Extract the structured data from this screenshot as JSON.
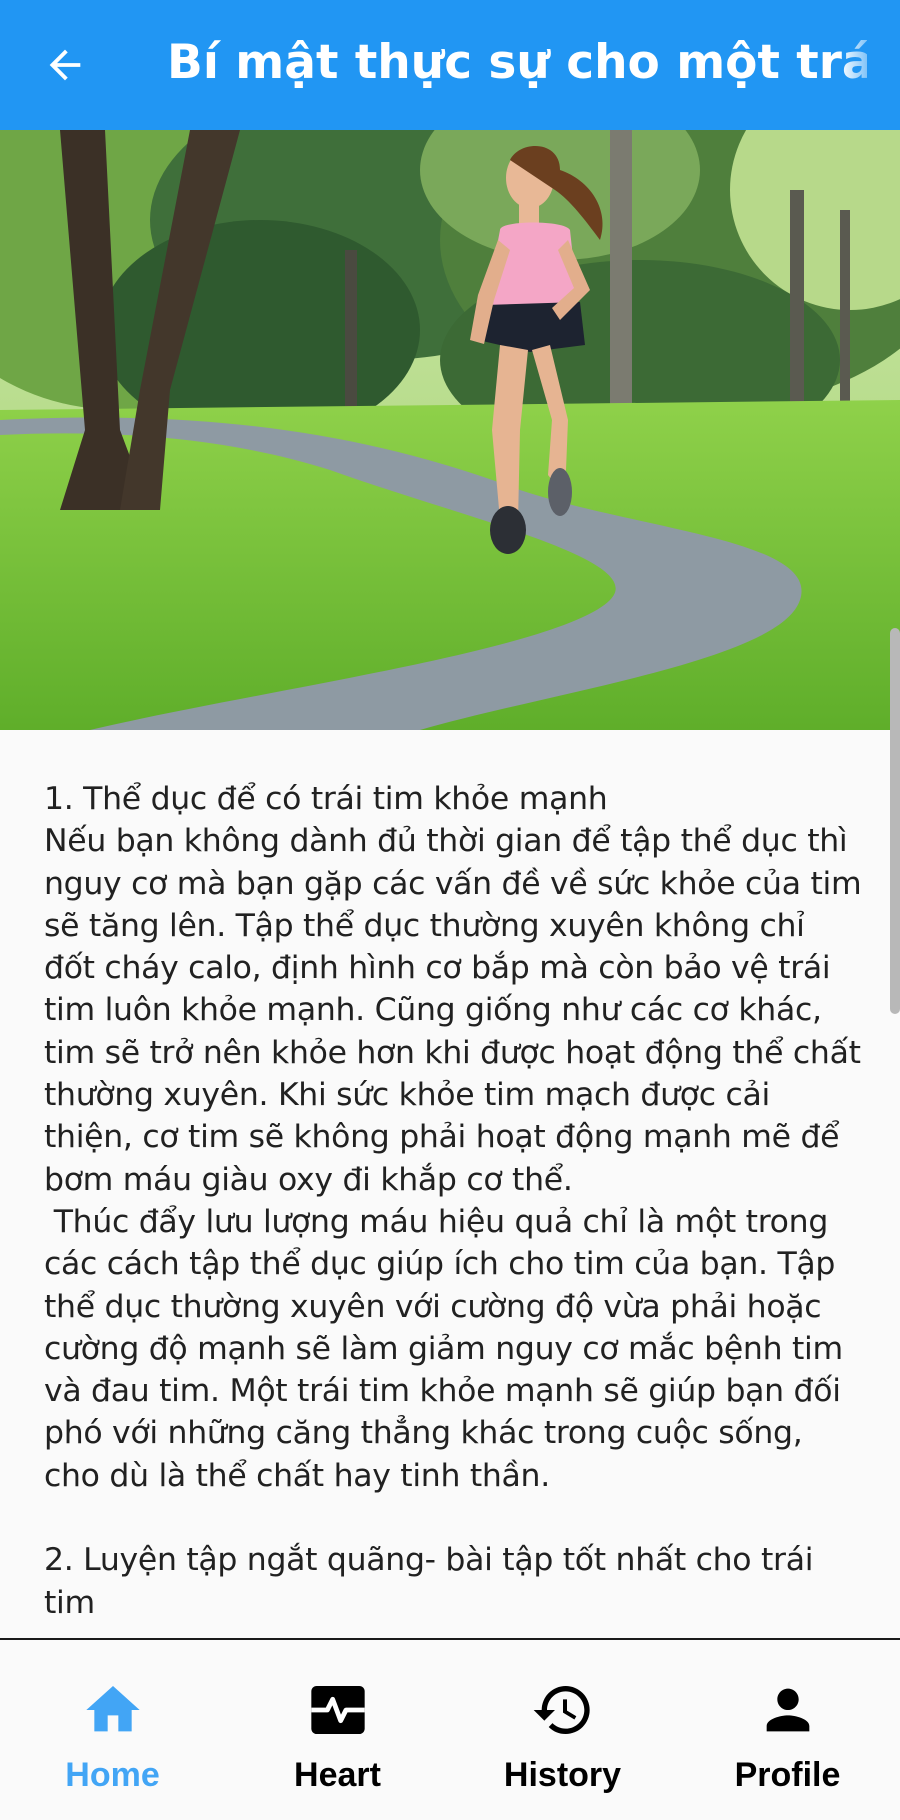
{
  "appbar": {
    "title": "Bí mật thực sự cho một trái tim khỏe mạnh",
    "color": "#2196f3"
  },
  "hero_image": {
    "icon": "photo-woman-jogging-park"
  },
  "article": {
    "body": "1. Thể dục để có trái tim khỏe mạnh\nNếu bạn không dành đủ thời gian để tập thể dục thì nguy cơ mà bạn gặp các vấn đề về sức khỏe của tim sẽ tăng lên. Tập thể dục thường xuyên không chỉ đốt cháy calo, định hình cơ bắp mà còn bảo vệ trái tim luôn khỏe mạnh. Cũng giống như các cơ khác, tim sẽ trở nên khỏe hơn khi được hoạt động thể chất thường xuyên. Khi sức khỏe tim mạch được cải thiện, cơ tim sẽ không phải hoạt động mạnh mẽ để bơm máu giàu oxy đi khắp cơ thể.\n Thúc đẩy lưu lượng máu hiệu quả chỉ là một trong các cách tập thể dục giúp ích cho tim của bạn. Tập thể dục thường xuyên với cường độ vừa phải hoặc cường độ mạnh sẽ làm giảm nguy cơ mắc bệnh tim và đau tim. Một trái tim khỏe mạnh sẽ giúp bạn đối phó với những căng thẳng khác trong cuộc sống, cho dù là thể chất hay tinh thần.\n\n2. Luyện tập ngắt quãng- bài tập tốt nhất cho trái tim"
  },
  "bottom_nav": {
    "active_color": "#42a5f5",
    "items": [
      {
        "label": "Home",
        "icon": "home-icon"
      },
      {
        "label": "Heart",
        "icon": "heart-monitor-icon"
      },
      {
        "label": "History",
        "icon": "history-icon"
      },
      {
        "label": "Profile",
        "icon": "person-icon"
      }
    ]
  }
}
